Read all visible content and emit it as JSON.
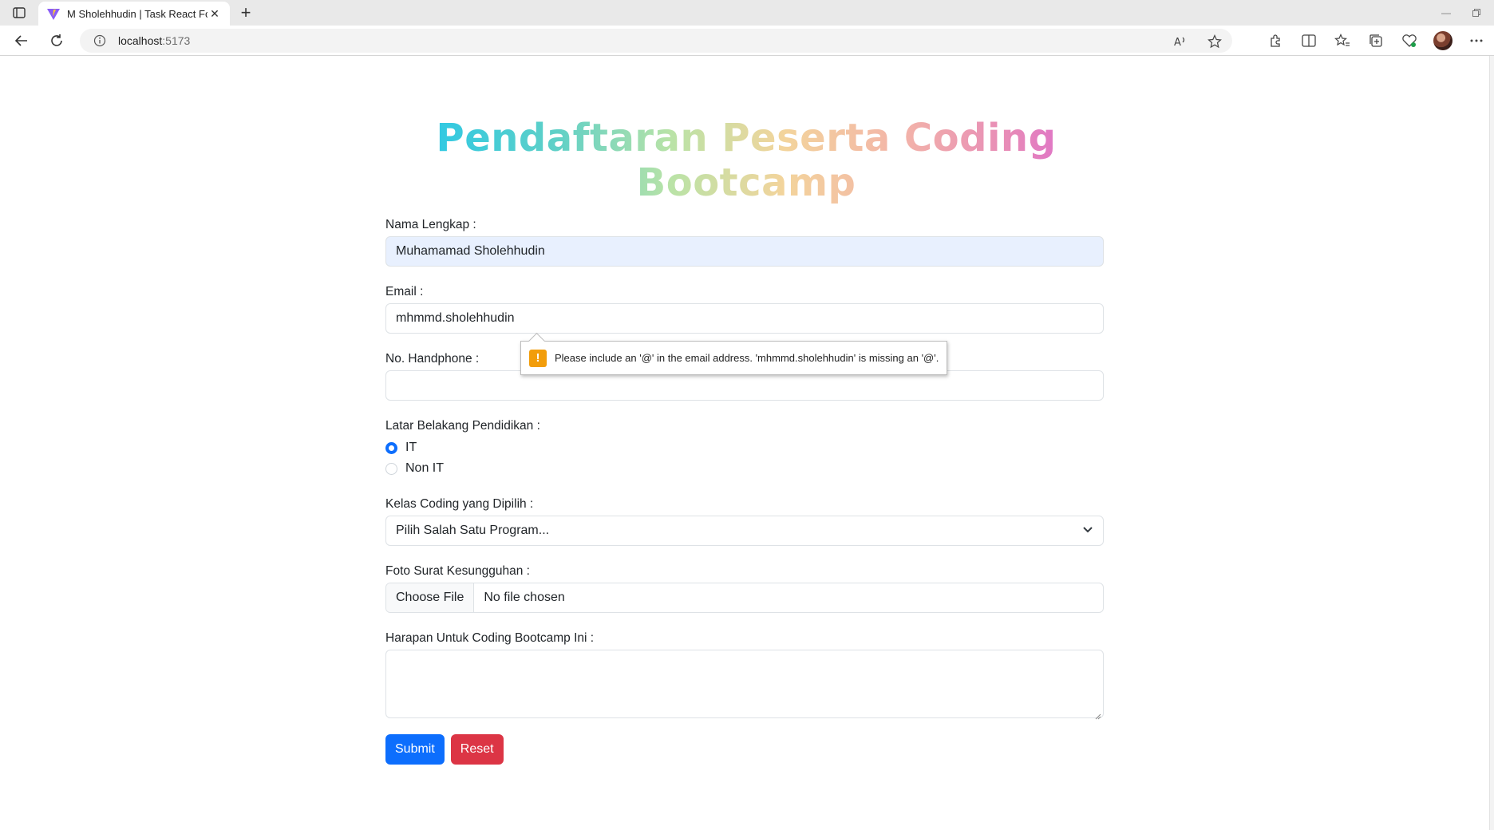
{
  "browser": {
    "tab_title": "M Sholehhudin | Task React Form",
    "url_host": "localhost",
    "url_port": ":5173"
  },
  "page": {
    "title": "Pendaftaran Peserta Coding Bootcamp"
  },
  "form": {
    "name_label": "Nama Lengkap :",
    "name_value": "Muhamamad Sholehhudin",
    "email_label": "Email :",
    "email_value": "mhmmd.sholehhudin",
    "phone_label": "No. Handphone :",
    "phone_value": "",
    "education_label": "Latar Belakang Pendidikan :",
    "education_options": [
      "IT",
      "Non IT"
    ],
    "education_selected": "IT",
    "class_label": "Kelas Coding yang Dipilih :",
    "class_value": "Pilih Salah Satu Program...",
    "file_label": "Foto Surat Kesungguhan :",
    "file_button": "Choose File",
    "file_status": "No file chosen",
    "hope_label": "Harapan Untuk Coding Bootcamp Ini :",
    "hope_value": "",
    "submit_label": "Submit",
    "reset_label": "Reset"
  },
  "validation": {
    "message": "Please include an '@' in the email address. 'mhmmd.sholehhudin' is missing an '@'.",
    "icon": "!"
  },
  "colors": {
    "primary": "#0d6efd",
    "danger": "#dc3545",
    "autofill": "#e8f0fe",
    "warning": "#f29d0b"
  }
}
